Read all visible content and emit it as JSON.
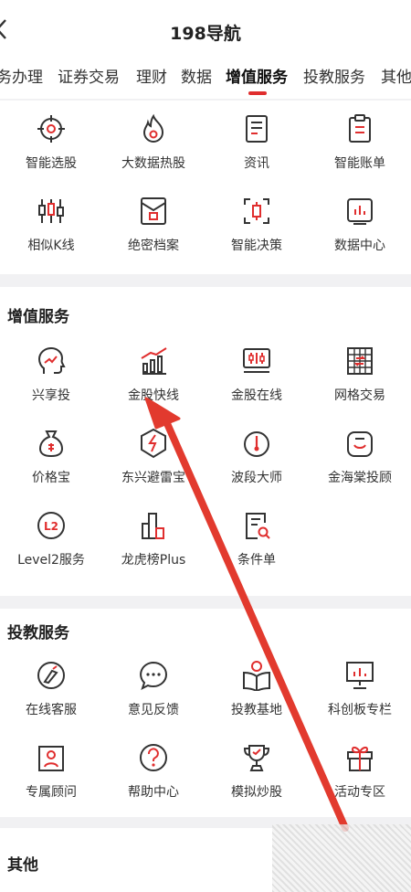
{
  "header": {
    "back_icon": "chevron-left-icon",
    "title": "198导航"
  },
  "tabs": [
    {
      "label": "务办理"
    },
    {
      "label": "证券交易"
    },
    {
      "label": "理财"
    },
    {
      "label": "数据"
    },
    {
      "label": "增值服务"
    },
    {
      "label": "投教服务"
    },
    {
      "label": "其他"
    }
  ],
  "active_tab_color": "#e02e2e",
  "section1": {
    "items": [
      {
        "label": "智能选股",
        "icon": "target-icon"
      },
      {
        "label": "大数据热股",
        "icon": "flame-icon"
      },
      {
        "label": "资讯",
        "icon": "news-icon"
      },
      {
        "label": "智能账单",
        "icon": "clipboard-icon"
      },
      {
        "label": "相似K线",
        "icon": "candlestick-icon"
      },
      {
        "label": "绝密档案",
        "icon": "secret-file-icon"
      },
      {
        "label": "智能决策",
        "icon": "decision-icon"
      },
      {
        "label": "数据中心",
        "icon": "data-center-icon"
      }
    ]
  },
  "section2": {
    "title": "增值服务",
    "items": [
      {
        "label": "兴享投",
        "icon": "head-growth-icon"
      },
      {
        "label": "金股快线",
        "icon": "rising-bars-icon"
      },
      {
        "label": "金股在线",
        "icon": "monitor-chart-icon"
      },
      {
        "label": "网格交易",
        "icon": "grid-icon"
      },
      {
        "label": "价格宝",
        "icon": "money-bag-icon"
      },
      {
        "label": "东兴避雷宝",
        "icon": "lightning-shield-icon"
      },
      {
        "label": "波段大师",
        "icon": "thermometer-icon"
      },
      {
        "label": "金海棠投顾",
        "icon": "advisor-icon"
      },
      {
        "label": "Level2服务",
        "icon": "level2-icon"
      },
      {
        "label": "龙虎榜Plus",
        "icon": "ranking-bars-icon"
      },
      {
        "label": "条件单",
        "icon": "search-document-icon"
      }
    ]
  },
  "section3": {
    "title": "投教服务",
    "items": [
      {
        "label": "在线客服",
        "icon": "headset-icon"
      },
      {
        "label": "意见反馈",
        "icon": "chat-bubble-icon"
      },
      {
        "label": "投教基地",
        "icon": "reading-icon"
      },
      {
        "label": "科创板专栏",
        "icon": "presentation-icon"
      },
      {
        "label": "专属顾问",
        "icon": "advisor-card-icon"
      },
      {
        "label": "帮助中心",
        "icon": "help-icon"
      },
      {
        "label": "模拟炒股",
        "icon": "trophy-icon"
      },
      {
        "label": "活动专区",
        "icon": "gift-icon"
      }
    ]
  },
  "section4": {
    "title": "其他"
  },
  "annotation_arrow_color": "#e23a2e"
}
